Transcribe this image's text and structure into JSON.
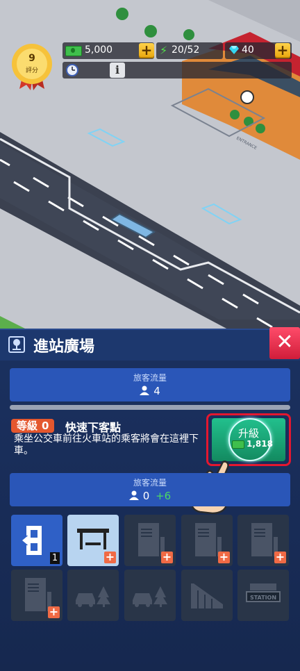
{
  "hud": {
    "rating": {
      "value": "9",
      "label": "評分"
    },
    "cash": {
      "value": "5,000"
    },
    "energy": {
      "value": "20/52"
    },
    "gems": {
      "value": "40"
    },
    "add_symbol": "+",
    "info_symbol": "i"
  },
  "scene": {
    "entrance_label": "ENTRANCE"
  },
  "panel": {
    "title": "進站廣場",
    "close_symbol": "✕",
    "passenger_flow_top": {
      "label": "旅客流量",
      "value": "4"
    },
    "skill": {
      "level_label": "等級",
      "level_value": "0",
      "name": "快速下客點",
      "description": "乘坐公交車前往火車站的乘客將會在這裡下車。"
    },
    "upgrade": {
      "label": "升級",
      "cost": "1,818"
    },
    "passenger_flow_bottom": {
      "label": "旅客流量",
      "value": "0",
      "bonus": "+6"
    }
  },
  "grid": {
    "entry_count": "1",
    "add_symbol": "+",
    "station_sign": "STATION"
  },
  "colors": {
    "panel_bg": "#16284f",
    "header_bg": "#1d386e",
    "flow_box": "#2a56b8",
    "upgrade_green": "#22c08d",
    "close_red": "#e4172f",
    "level_orange": "#e4572e",
    "bonus_green": "#4cd964"
  }
}
